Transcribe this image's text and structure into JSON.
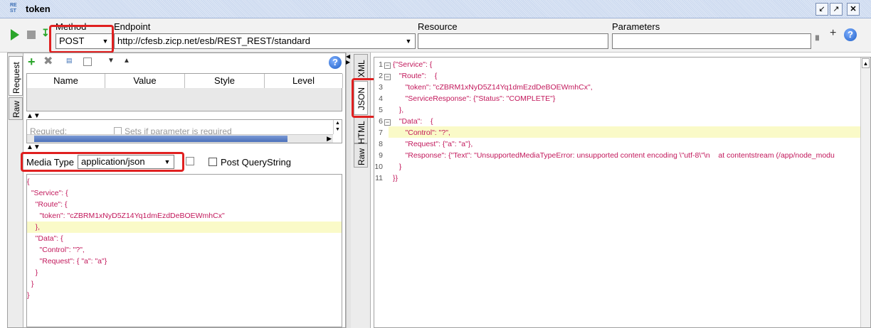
{
  "window": {
    "title": "token",
    "app_icon_text": "RE ST"
  },
  "toolbar": {
    "method_label": "Method",
    "method_value": "POST",
    "endpoint_label": "Endpoint",
    "endpoint_value": "http://cfesb.zicp.net/esb/REST_REST/standard",
    "resource_label": "Resource",
    "resource_value": "",
    "parameters_label": "Parameters",
    "parameters_value": "",
    "help_glyph": "?"
  },
  "request_panel": {
    "vtab_request": "Request",
    "vtab_raw": "Raw",
    "columns": [
      "Name",
      "Value",
      "Style",
      "Level"
    ],
    "required_label": "Required:",
    "sets_if_required_label": "Sets if parameter is required",
    "media_type_label": "Media Type",
    "media_type_value": "application/json",
    "post_querystring_label": "Post QueryString",
    "body_lines": [
      "{",
      "  \"Service\": {",
      "    \"Route\": {",
      "      \"token\": \"cZBRM1xNyD5Z14Yq1dmEzdDeBOEWmhCx\"",
      "    },",
      "    \"Data\": {",
      "      \"Control\": \"?\",",
      "      \"Request\": { \"a\": \"a\"}",
      "    }",
      "  }",
      "}"
    ]
  },
  "response_panel": {
    "vtab_xml": "XML",
    "vtab_json": "JSON",
    "vtab_html": "HTML",
    "vtab_raw": "Raw",
    "line_numbers": [
      "1",
      "2",
      "3",
      "4",
      "5",
      "6",
      "7",
      "8",
      "9",
      "10",
      "11"
    ],
    "lines": [
      "{\"Service\": {",
      "   \"Route\":    {",
      "      \"token\": \"cZBRM1xNyD5Z14Yq1dmEzdDeBOEWmhCx\",",
      "      \"ServiceResponse\": {\"Status\": \"COMPLETE\"}",
      "   },",
      "   \"Data\":    {",
      "      \"Control\": \"?\",",
      "      \"Request\": {\"a\": \"a\"},",
      "      \"Response\": {\"Text\": \"UnsupportedMediaTypeError: unsupported content encoding \\\"utf-8\\\"\\n    at contentstream (/app/node_modu",
      "   }",
      "}}"
    ]
  },
  "colors": {
    "highlight": "#e02020",
    "code_text": "#c2185b",
    "current_line": "#fafac8"
  }
}
